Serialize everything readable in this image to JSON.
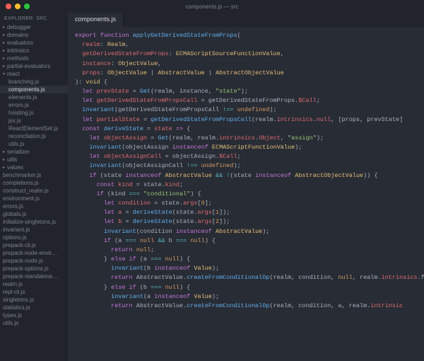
{
  "window": {
    "title": "components.js — src"
  },
  "explorer": {
    "label": "EXPLORER: SRC",
    "items": [
      {
        "name": "debugger",
        "type": "folder",
        "level": 0
      },
      {
        "name": "domains",
        "type": "folder",
        "level": 0
      },
      {
        "name": "evaluators",
        "type": "folder",
        "level": 0
      },
      {
        "name": "intrinsics",
        "type": "folder",
        "level": 0
      },
      {
        "name": "methods",
        "type": "folder",
        "level": 0
      },
      {
        "name": "partial-evaluators",
        "type": "folder",
        "level": 0
      },
      {
        "name": "react",
        "type": "folder",
        "level": 0,
        "expanded": true
      },
      {
        "name": "branching.js",
        "type": "file",
        "level": 1
      },
      {
        "name": "components.js",
        "type": "file",
        "level": 1,
        "active": true
      },
      {
        "name": "elements.js",
        "type": "file",
        "level": 1
      },
      {
        "name": "errors.js",
        "type": "file",
        "level": 1
      },
      {
        "name": "hoisting.js",
        "type": "file",
        "level": 1
      },
      {
        "name": "jsx.js",
        "type": "file",
        "level": 1
      },
      {
        "name": "ReactElementSet.js",
        "type": "file",
        "level": 1
      },
      {
        "name": "reconcilation.js",
        "type": "file",
        "level": 1
      },
      {
        "name": "utils.js",
        "type": "file",
        "level": 1
      },
      {
        "name": "serializer",
        "type": "folder",
        "level": 0
      },
      {
        "name": "utils",
        "type": "folder",
        "level": 0
      },
      {
        "name": "values",
        "type": "folder",
        "level": 0
      },
      {
        "name": "benchmarker.js",
        "type": "file",
        "level": 0
      },
      {
        "name": "completions.js",
        "type": "file",
        "level": 0
      },
      {
        "name": "construct_realm.js",
        "type": "file",
        "level": 0
      },
      {
        "name": "environment.js",
        "type": "file",
        "level": 0
      },
      {
        "name": "errors.js",
        "type": "file",
        "level": 0
      },
      {
        "name": "globals.js",
        "type": "file",
        "level": 0
      },
      {
        "name": "initialize-singletons.js",
        "type": "file",
        "level": 0
      },
      {
        "name": "invariant.js",
        "type": "file",
        "level": 0
      },
      {
        "name": "options.js",
        "type": "file",
        "level": 0
      },
      {
        "name": "prepack-cli.js",
        "type": "file",
        "level": 0
      },
      {
        "name": "prepack-node-envir…",
        "type": "file",
        "level": 0
      },
      {
        "name": "prepack-node.js",
        "type": "file",
        "level": 0
      },
      {
        "name": "prepack-options.js",
        "type": "file",
        "level": 0
      },
      {
        "name": "prepack-standalone…",
        "type": "file",
        "level": 0
      },
      {
        "name": "realm.js",
        "type": "file",
        "level": 0
      },
      {
        "name": "repl-cli.js",
        "type": "file",
        "level": 0
      },
      {
        "name": "singletons.js",
        "type": "file",
        "level": 0
      },
      {
        "name": "statistics.js",
        "type": "file",
        "level": 0
      },
      {
        "name": "types.js",
        "type": "file",
        "level": 0
      },
      {
        "name": "utils.js",
        "type": "file",
        "level": 0
      }
    ]
  },
  "tabs": [
    {
      "label": "components.js"
    }
  ],
  "code": {
    "lines": [
      [
        [
          "kw",
          "export"
        ],
        [
          "punct",
          " "
        ],
        [
          "kw",
          "function"
        ],
        [
          "punct",
          " "
        ],
        [
          "call",
          "applyGetDerivedStateFromProps"
        ],
        [
          "punct",
          "("
        ]
      ],
      [
        [
          "punct",
          "  "
        ],
        [
          "var",
          "realm"
        ],
        [
          "punct",
          ": "
        ],
        [
          "type",
          "Realm"
        ],
        [
          "punct",
          ","
        ]
      ],
      [
        [
          "punct",
          "  "
        ],
        [
          "var",
          "getDerivedStateFromProps"
        ],
        [
          "punct",
          ": "
        ],
        [
          "type",
          "ECMAScriptSourceFunctionValue"
        ],
        [
          "punct",
          ","
        ]
      ],
      [
        [
          "punct",
          "  "
        ],
        [
          "var",
          "instance"
        ],
        [
          "punct",
          ": "
        ],
        [
          "type",
          "ObjectValue"
        ],
        [
          "punct",
          ","
        ]
      ],
      [
        [
          "punct",
          "  "
        ],
        [
          "var",
          "props"
        ],
        [
          "punct",
          ": "
        ],
        [
          "type",
          "ObjectValue"
        ],
        [
          "punct",
          " | "
        ],
        [
          "type",
          "AbstractValue"
        ],
        [
          "punct",
          " | "
        ],
        [
          "type",
          "AbstractObjectValue"
        ]
      ],
      [
        [
          "punct",
          "): "
        ],
        [
          "type",
          "void"
        ],
        [
          "punct",
          " {"
        ]
      ],
      [
        [
          "punct",
          "  "
        ],
        [
          "kw",
          "let"
        ],
        [
          "punct",
          " "
        ],
        [
          "var",
          "prevState"
        ],
        [
          "punct",
          " = "
        ],
        [
          "call",
          "Get"
        ],
        [
          "punct",
          "(realm, instance, "
        ],
        [
          "str",
          "\"state\""
        ],
        [
          "punct",
          ");"
        ]
      ],
      [
        [
          "punct",
          "  "
        ],
        [
          "kw",
          "let"
        ],
        [
          "punct",
          " "
        ],
        [
          "var",
          "getDerivedStateFromPropsCall"
        ],
        [
          "punct",
          " = getDerivedStateFromProps."
        ],
        [
          "prop",
          "$Call"
        ],
        [
          "punct",
          ";"
        ]
      ],
      [
        [
          "punct",
          "  "
        ],
        [
          "call",
          "invariant"
        ],
        [
          "punct",
          "(getDerivedStateFromPropsCall "
        ],
        [
          "op",
          "!=="
        ],
        [
          "punct",
          " "
        ],
        [
          "const",
          "undefined"
        ],
        [
          "punct",
          ");"
        ]
      ],
      [
        [
          "punct",
          "  "
        ],
        [
          "kw",
          "let"
        ],
        [
          "punct",
          " "
        ],
        [
          "var",
          "partialState"
        ],
        [
          "punct",
          " = "
        ],
        [
          "call",
          "getDerivedStateFromPropsCall"
        ],
        [
          "punct",
          "(realm."
        ],
        [
          "prop",
          "intrinsics"
        ],
        [
          "punct",
          "."
        ],
        [
          "prop",
          "null"
        ],
        [
          "punct",
          ", [props, prevState]"
        ]
      ],
      [
        [
          "punct",
          ""
        ]
      ],
      [
        [
          "punct",
          "  "
        ],
        [
          "kw",
          "const"
        ],
        [
          "punct",
          " "
        ],
        [
          "call",
          "deriveState"
        ],
        [
          "punct",
          " = "
        ],
        [
          "var",
          "state"
        ],
        [
          "punct",
          " "
        ],
        [
          "kw",
          "=>"
        ],
        [
          "punct",
          " {"
        ]
      ],
      [
        [
          "punct",
          "    "
        ],
        [
          "kw",
          "let"
        ],
        [
          "punct",
          " "
        ],
        [
          "var",
          "objectAssign"
        ],
        [
          "punct",
          " = "
        ],
        [
          "call",
          "Get"
        ],
        [
          "punct",
          "(realm, realm."
        ],
        [
          "prop",
          "intrinsics"
        ],
        [
          "punct",
          "."
        ],
        [
          "prop",
          "Object"
        ],
        [
          "punct",
          ", "
        ],
        [
          "str",
          "\"assign\""
        ],
        [
          "punct",
          ");"
        ]
      ],
      [
        [
          "punct",
          "    "
        ],
        [
          "call",
          "invariant"
        ],
        [
          "punct",
          "(objectAssign "
        ],
        [
          "kw",
          "instanceof"
        ],
        [
          "punct",
          " "
        ],
        [
          "type",
          "ECMAScriptFunctionValue"
        ],
        [
          "punct",
          ");"
        ]
      ],
      [
        [
          "punct",
          "    "
        ],
        [
          "kw",
          "let"
        ],
        [
          "punct",
          " "
        ],
        [
          "var",
          "objectAssignCall"
        ],
        [
          "punct",
          " = objectAssign."
        ],
        [
          "prop",
          "$Call"
        ],
        [
          "punct",
          ";"
        ]
      ],
      [
        [
          "punct",
          "    "
        ],
        [
          "call",
          "invariant"
        ],
        [
          "punct",
          "(objectAssignCall "
        ],
        [
          "op",
          "!=="
        ],
        [
          "punct",
          " "
        ],
        [
          "const",
          "undefined"
        ],
        [
          "punct",
          ");"
        ]
      ],
      [
        [
          "punct",
          ""
        ]
      ],
      [
        [
          "punct",
          "    "
        ],
        [
          "kw",
          "if"
        ],
        [
          "punct",
          " (state "
        ],
        [
          "kw",
          "instanceof"
        ],
        [
          "punct",
          " "
        ],
        [
          "type",
          "AbstractValue"
        ],
        [
          "punct",
          " "
        ],
        [
          "op",
          "&&"
        ],
        [
          "punct",
          " "
        ],
        [
          "op",
          "!"
        ],
        [
          "punct",
          "(state "
        ],
        [
          "kw",
          "instanceof"
        ],
        [
          "punct",
          " "
        ],
        [
          "type",
          "AbstractObjectValue"
        ],
        [
          "punct",
          ")) {"
        ]
      ],
      [
        [
          "punct",
          "      "
        ],
        [
          "kw",
          "const"
        ],
        [
          "punct",
          " "
        ],
        [
          "var",
          "kind"
        ],
        [
          "punct",
          " = state."
        ],
        [
          "prop",
          "kind"
        ],
        [
          "punct",
          ";"
        ]
      ],
      [
        [
          "punct",
          ""
        ]
      ],
      [
        [
          "punct",
          "      "
        ],
        [
          "kw",
          "if"
        ],
        [
          "punct",
          " (kind "
        ],
        [
          "op",
          "==="
        ],
        [
          "punct",
          " "
        ],
        [
          "str",
          "\"conditional\""
        ],
        [
          "punct",
          ") {"
        ]
      ],
      [
        [
          "punct",
          "        "
        ],
        [
          "kw",
          "let"
        ],
        [
          "punct",
          " "
        ],
        [
          "var",
          "condition"
        ],
        [
          "punct",
          " = state."
        ],
        [
          "prop",
          "args"
        ],
        [
          "punct",
          "["
        ],
        [
          "num",
          "0"
        ],
        [
          "punct",
          "];"
        ]
      ],
      [
        [
          "punct",
          "        "
        ],
        [
          "kw",
          "let"
        ],
        [
          "punct",
          " "
        ],
        [
          "var",
          "a"
        ],
        [
          "punct",
          " = "
        ],
        [
          "call",
          "deriveState"
        ],
        [
          "punct",
          "(state."
        ],
        [
          "prop",
          "args"
        ],
        [
          "punct",
          "["
        ],
        [
          "num",
          "1"
        ],
        [
          "punct",
          "]);"
        ]
      ],
      [
        [
          "punct",
          "        "
        ],
        [
          "kw",
          "let"
        ],
        [
          "punct",
          " "
        ],
        [
          "var",
          "b"
        ],
        [
          "punct",
          " = "
        ],
        [
          "call",
          "deriveState"
        ],
        [
          "punct",
          "(state."
        ],
        [
          "prop",
          "args"
        ],
        [
          "punct",
          "["
        ],
        [
          "num",
          "2"
        ],
        [
          "punct",
          "]);"
        ]
      ],
      [
        [
          "punct",
          "        "
        ],
        [
          "call",
          "invariant"
        ],
        [
          "punct",
          "(condition "
        ],
        [
          "kw",
          "instanceof"
        ],
        [
          "punct",
          " "
        ],
        [
          "type",
          "AbstractValue"
        ],
        [
          "punct",
          ");"
        ]
      ],
      [
        [
          "punct",
          "        "
        ],
        [
          "kw",
          "if"
        ],
        [
          "punct",
          " (a "
        ],
        [
          "op",
          "==="
        ],
        [
          "punct",
          " "
        ],
        [
          "const",
          "null"
        ],
        [
          "punct",
          " "
        ],
        [
          "op",
          "&&"
        ],
        [
          "punct",
          " b "
        ],
        [
          "op",
          "==="
        ],
        [
          "punct",
          " "
        ],
        [
          "const",
          "null"
        ],
        [
          "punct",
          ") {"
        ]
      ],
      [
        [
          "punct",
          "          "
        ],
        [
          "kw",
          "return"
        ],
        [
          "punct",
          " "
        ],
        [
          "const",
          "null"
        ],
        [
          "punct",
          ";"
        ]
      ],
      [
        [
          "punct",
          "        } "
        ],
        [
          "kw",
          "else if"
        ],
        [
          "punct",
          " (a "
        ],
        [
          "op",
          "==="
        ],
        [
          "punct",
          " "
        ],
        [
          "const",
          "null"
        ],
        [
          "punct",
          ") {"
        ]
      ],
      [
        [
          "punct",
          "          "
        ],
        [
          "call",
          "invariant"
        ],
        [
          "punct",
          "(b "
        ],
        [
          "kw",
          "instanceof"
        ],
        [
          "punct",
          " "
        ],
        [
          "type",
          "Value"
        ],
        [
          "punct",
          ");"
        ]
      ],
      [
        [
          "punct",
          "          "
        ],
        [
          "kw",
          "return"
        ],
        [
          "punct",
          " AbstractValue."
        ],
        [
          "call",
          "createFromConditionalOp"
        ],
        [
          "punct",
          "(realm, condition, "
        ],
        [
          "const",
          "null"
        ],
        [
          "punct",
          ", realm."
        ],
        [
          "prop",
          "intrinsics"
        ],
        [
          "punct",
          ".f"
        ]
      ],
      [
        [
          "punct",
          "        } "
        ],
        [
          "kw",
          "else if"
        ],
        [
          "punct",
          " (b "
        ],
        [
          "op",
          "==="
        ],
        [
          "punct",
          " "
        ],
        [
          "const",
          "null"
        ],
        [
          "punct",
          ") {"
        ]
      ],
      [
        [
          "punct",
          "          "
        ],
        [
          "call",
          "invariant"
        ],
        [
          "punct",
          "(a "
        ],
        [
          "kw",
          "instanceof"
        ],
        [
          "punct",
          " "
        ],
        [
          "type",
          "Value"
        ],
        [
          "punct",
          ");"
        ]
      ],
      [
        [
          "punct",
          "          "
        ],
        [
          "kw",
          "return"
        ],
        [
          "punct",
          " AbstractValue."
        ],
        [
          "call",
          "createFromConditionalOp"
        ],
        [
          "punct",
          "(realm, condition, a, realm."
        ],
        [
          "prop",
          "intrinsic"
        ]
      ]
    ]
  }
}
